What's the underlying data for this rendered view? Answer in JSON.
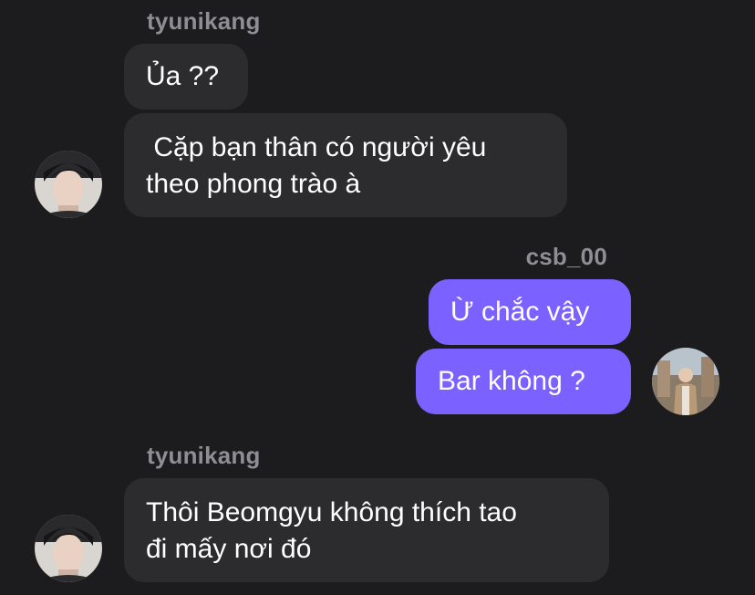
{
  "messages": [
    {
      "sender": "tyunikang",
      "lines": [
        "Ủa ??",
        " Cặp bạn thân có người yêu\ntheo phong trào à"
      ],
      "direction": "incoming"
    },
    {
      "sender": "csb_00",
      "lines": [
        "Ừ chắc vậy",
        "Bar không ?"
      ],
      "direction": "outgoing"
    },
    {
      "sender": "tyunikang",
      "lines": [
        "Thôi Beomgyu không thích tao\nđi mấy nơi đó"
      ],
      "direction": "incoming"
    }
  ],
  "colors": {
    "background": "#1c1c1e",
    "incoming_bubble": "#2c2c2e",
    "outgoing_bubble": "#7b61ff",
    "sender_name": "#8e8e93"
  },
  "icons": {
    "incoming_avatar": "profile-photo-tyunikang",
    "outgoing_avatar": "profile-photo-csb_00"
  }
}
